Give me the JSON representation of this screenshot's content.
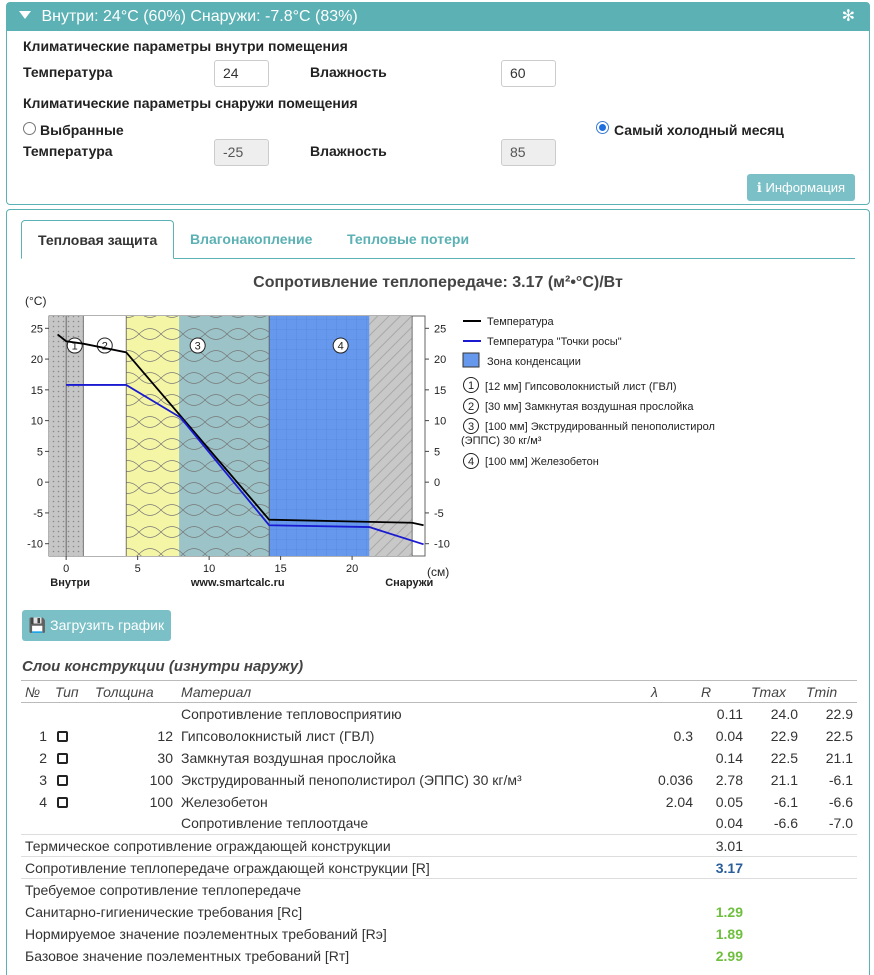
{
  "header": {
    "title": "Внутри: 24°C (60%) Снаружи: -7.8°C (83%)",
    "gear": "✻"
  },
  "indoor": {
    "heading": "Климатические параметры внутри помещения",
    "temp_label": "Температура",
    "temp_value": "24",
    "humidity_label": "Влажность",
    "humidity_value": "60"
  },
  "outdoor": {
    "heading": "Климатические параметры снаружи помещения",
    "opt_selected": "Выбранные",
    "opt_coldest": "Самый холодный месяц",
    "temp_label": "Температура",
    "temp_value": "-25",
    "humidity_label": "Влажность",
    "humidity_value": "85"
  },
  "info_button": "Информация",
  "tabs": [
    "Тепловая защита",
    "Влагонакопление",
    "Тепловые потери"
  ],
  "chart_title": "Сопротивление теплопередаче: 3.17 (м²•°С)/Вт",
  "chart_data": {
    "type": "line",
    "ylabel": "(°C)",
    "xlabel": "(см)",
    "ylim": [
      -12,
      27
    ],
    "xlim": [
      -1.2,
      25.1
    ],
    "xticks": [
      0,
      5,
      10,
      15,
      20
    ],
    "yticks": [
      25,
      20,
      15,
      10,
      5,
      0,
      -5,
      -10
    ],
    "x_left_label": "Внутри",
    "x_center_label": "www.smartcalc.ru",
    "x_right_label": "Снаружи",
    "legend": {
      "temperature": "Температура",
      "dew": "Температура \"Точки росы\"",
      "condensation": "Зона конденсации"
    },
    "layers": [
      {
        "num": "1",
        "label": "[12 мм] Гипсоволокнистый лист (ГВЛ)",
        "x0": 0,
        "x1": 1.2
      },
      {
        "num": "2",
        "label": "[30 мм] Замкнутая воздушная прослойка",
        "x0": 1.2,
        "x1": 4.2
      },
      {
        "num": "3",
        "label": "[100 мм] Экструдированный пенополистирол (ЭППС) 30 кг/м³",
        "x0": 4.2,
        "x1": 14.2
      },
      {
        "num": "4",
        "label": "[100 мм] Железобетон",
        "x0": 14.2,
        "x1": 24.2
      }
    ],
    "condensation_zone": [
      14.2,
      21.2
    ],
    "series": [
      {
        "name": "Температура",
        "color": "#000000",
        "x": [
          -0.6,
          0,
          1.2,
          4.2,
          14.2,
          24.2,
          25
        ],
        "y": [
          24.0,
          22.9,
          22.5,
          21.1,
          -6.1,
          -6.6,
          -7.0
        ]
      },
      {
        "name": "Температура \"Точки росы\"",
        "color": "#1a1ad0",
        "x": [
          0,
          4.2,
          8.0,
          14.2,
          21.2,
          25
        ],
        "y": [
          15.8,
          15.8,
          10.5,
          -7.0,
          -7.3,
          -10.1
        ]
      }
    ]
  },
  "download_button": "Загрузить график",
  "layers_table": {
    "title": "Слои конструкции (изнутри наружу)",
    "headers": [
      "№",
      "Тип",
      "Толщина",
      "Материал",
      "λ",
      "R",
      "Tmax",
      "Tmin"
    ],
    "rows": [
      {
        "num": "",
        "chk": false,
        "thickness": "",
        "material": "Сопротивление тепловосприятию",
        "lambda": "",
        "r": "0.11",
        "tmax": "24.0",
        "tmin": "22.9"
      },
      {
        "num": "1",
        "chk": true,
        "thickness": "12",
        "material": "Гипсоволокнистый лист (ГВЛ)",
        "lambda": "0.3",
        "r": "0.04",
        "tmax": "22.9",
        "tmin": "22.5"
      },
      {
        "num": "2",
        "chk": true,
        "thickness": "30",
        "material": "Замкнутая воздушная прослойка",
        "lambda": "",
        "r": "0.14",
        "tmax": "22.5",
        "tmin": "21.1"
      },
      {
        "num": "3",
        "chk": true,
        "thickness": "100",
        "material": "Экструдированный пенополистирол (ЭППС) 30 кг/м³",
        "lambda": "0.036",
        "r": "2.78",
        "tmax": "21.1",
        "tmin": "-6.1"
      },
      {
        "num": "4",
        "chk": true,
        "thickness": "100",
        "material": "Железобетон",
        "lambda": "2.04",
        "r": "0.05",
        "tmax": "-6.1",
        "tmin": "-6.6"
      },
      {
        "num": "",
        "chk": false,
        "thickness": "",
        "material": "Сопротивление теплоотдаче",
        "lambda": "",
        "r": "0.04",
        "tmax": "-6.6",
        "tmin": "-7.0"
      }
    ],
    "thermal_label": "Термическое сопротивление ограждающей конструкции",
    "thermal_value": "3.01",
    "total_label": "Сопротивление теплопередаче ограждающей конструкции [R]",
    "total_value": "3.17",
    "required_heading": "Требуемое сопротивление теплопередаче",
    "req_sanitary_label": "Санитарно-гигиенические требования [Rc]",
    "req_sanitary_value": "1.29",
    "req_norm_label": "Нормируемое значение поэлементных требований [Rэ]",
    "req_norm_value": "1.89",
    "req_base_label": "Базовое значение поэлементных требований [Rт]",
    "req_base_value": "2.99"
  }
}
